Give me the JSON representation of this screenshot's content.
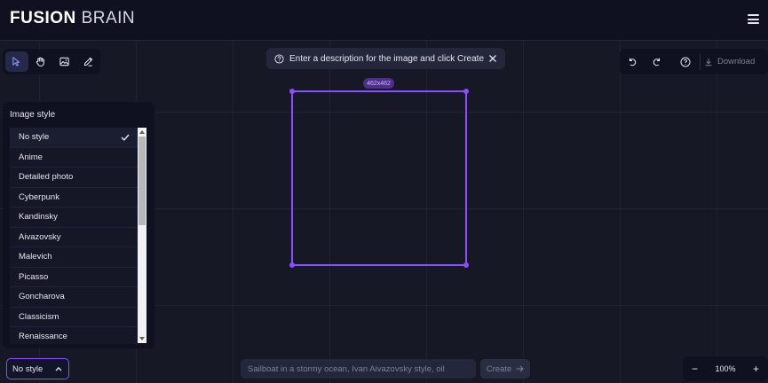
{
  "header": {
    "logo_bold": "FUSION",
    "logo_light": "BRAIN",
    "menu_icon": "hamburger-menu-icon"
  },
  "toolbar_left": {
    "tools": [
      "pointer-icon",
      "hand-icon",
      "image-icon",
      "pencil-icon"
    ],
    "active_tool": "pointer-icon"
  },
  "hint": {
    "text": "Enter a description for the image and click Create",
    "icons": [
      "question-circle-icon",
      "close-icon"
    ]
  },
  "toolbar_right": {
    "icons": [
      "undo-icon",
      "redo-icon",
      "help-icon",
      "download-icon"
    ],
    "download_label": "Download"
  },
  "style_panel": {
    "title": "Image style",
    "items": [
      {
        "label": "No style",
        "selected": true
      },
      {
        "label": "Anime"
      },
      {
        "label": "Detailed photo"
      },
      {
        "label": "Cyberpunk"
      },
      {
        "label": "Kandinsky"
      },
      {
        "label": "Aivazovsky"
      },
      {
        "label": "Malevich"
      },
      {
        "label": "Picasso"
      },
      {
        "label": "Goncharova"
      },
      {
        "label": "Classicism"
      },
      {
        "label": "Renaissance"
      }
    ]
  },
  "canvas": {
    "size_label": "462x462"
  },
  "bottom": {
    "style_select_value": "No style",
    "prompt_placeholder": "Sailboat in a stormy ocean, Ivan Aivazovsky style, oil",
    "create_label": "Create",
    "zoom_minus": "−",
    "zoom_value": "100%",
    "zoom_plus": "+"
  },
  "colors": {
    "accent": "#8a4dff",
    "background": "#161826",
    "panel": "#0f1120"
  }
}
